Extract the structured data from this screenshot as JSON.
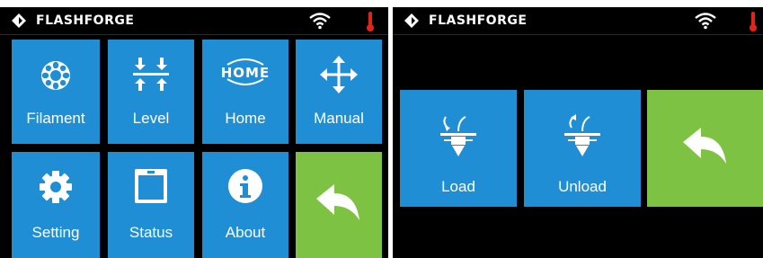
{
  "left_screen": {
    "status_bar": {
      "brand": "FLASHFORGE",
      "icons": [
        "flashforge-logo-icon",
        "wifi-icon",
        "thermometer-icon"
      ]
    },
    "tiles": [
      {
        "label": "Filament",
        "icon": "filament-icon"
      },
      {
        "label": "Level",
        "icon": "level-icon"
      },
      {
        "label": "Home",
        "icon": "home-icon",
        "icon_text": "HOME"
      },
      {
        "label": "Manual",
        "icon": "move-arrows-icon"
      },
      {
        "label": "Setting",
        "icon": "gear-icon"
      },
      {
        "label": "Status",
        "icon": "status-icon"
      },
      {
        "label": "About",
        "icon": "info-icon"
      },
      {
        "label": "",
        "icon": "back-arrow-icon"
      }
    ]
  },
  "right_screen": {
    "status_bar": {
      "brand": "FLASHFORGE",
      "icons": [
        "flashforge-logo-icon",
        "wifi-icon",
        "thermometer-icon"
      ]
    },
    "tiles": [
      {
        "label": "Load",
        "icon": "load-filament-icon"
      },
      {
        "label": "Unload",
        "icon": "unload-filament-icon"
      },
      {
        "label": "",
        "icon": "back-arrow-icon"
      }
    ]
  },
  "colors": {
    "tile_blue": "#1f8ed4",
    "back_green": "#7dc242",
    "background": "#000000",
    "thermometer_red": "#e1251b"
  }
}
